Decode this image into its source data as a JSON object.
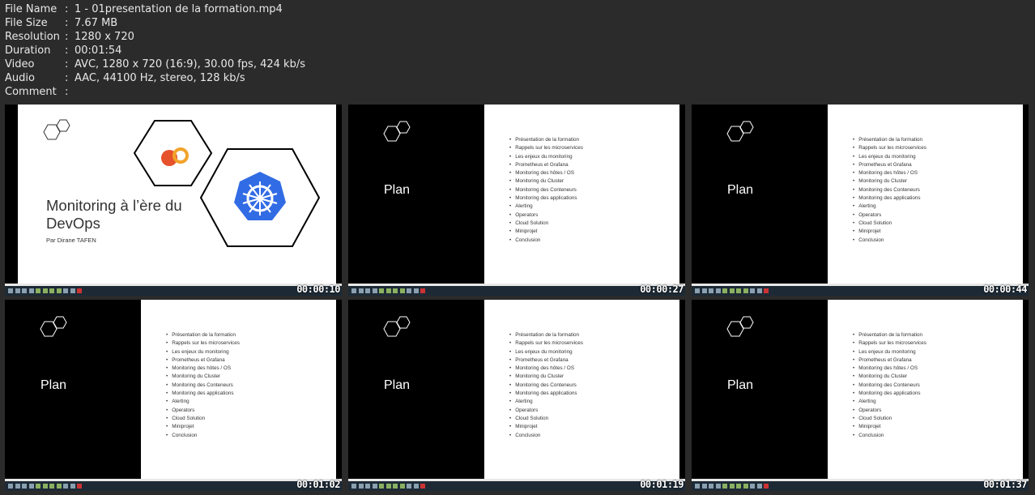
{
  "info": [
    {
      "key": "File Name",
      "value": "1 - 01presentation de la formation.mp4"
    },
    {
      "key": "File Size",
      "value": "7.67 MB"
    },
    {
      "key": "Resolution",
      "value": "1280 x 720"
    },
    {
      "key": "Duration",
      "value": "00:01:54"
    },
    {
      "key": "Video",
      "value": "AVC, 1280 x 720 (16:9), 30.00 fps, 424 kb/s"
    },
    {
      "key": "Audio",
      "value": "AAC, 44100 Hz, stereo, 128 kb/s"
    },
    {
      "key": "Comment",
      "value": ""
    }
  ],
  "separator": ":",
  "title_slide": {
    "title": "Monitoring à l’ère du DevOps",
    "author": "Par Dirane TAFEN"
  },
  "plan_slide": {
    "heading": "Plan",
    "items": [
      "Présentation de la formation",
      "Rappels sur les microservices",
      "Les enjeux du monitoring",
      "Prometheus et Grafana",
      "Monitoring des hôtes / OS",
      "Monitoring du Cluster",
      "Monitoring des Conteneurs",
      "Monitoring des applications",
      "Alerting",
      "Operators",
      "Cloud Solution",
      "Miniprojet",
      "Conclusion"
    ]
  },
  "thumbnails": [
    {
      "type": "title",
      "timestamp": "00:00:10"
    },
    {
      "type": "plan",
      "timestamp": "00:00:27"
    },
    {
      "type": "plan",
      "timestamp": "00:00:44"
    },
    {
      "type": "plan",
      "timestamp": "00:01:02"
    },
    {
      "type": "plan",
      "timestamp": "00:01:19"
    },
    {
      "type": "plan",
      "timestamp": "00:01:37"
    }
  ],
  "colors": {
    "kubernetes": "#326ce5",
    "prometheus": "#e6522c",
    "grafana": "#f2a32a"
  }
}
